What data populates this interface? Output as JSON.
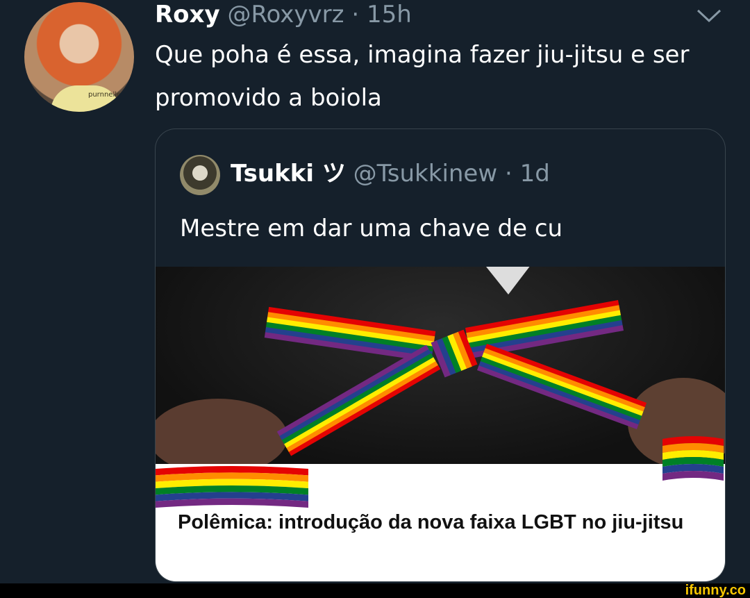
{
  "tweet": {
    "name": "Roxy",
    "handle": "@Roxyvrz",
    "separator": "·",
    "time": "15h",
    "text": "Que poha é essa, imagina fazer jiu-jitsu e ser promovido a boiola",
    "avatar_shirt_text": "purnnelle"
  },
  "quoted": {
    "name": "Tsukki ツ",
    "handle": "@Tsukkinew",
    "separator": "·",
    "time": "1d",
    "text": "Mestre em dar uma chave de cu",
    "caption": "Polêmica: introdução da nova faixa LGBT no jiu-jitsu"
  },
  "watermark": "ifunny.co",
  "colors": {
    "background": "#15202b",
    "muted": "#8899a6",
    "border": "#38444d",
    "rainbow": [
      "#e40303",
      "#ff8c00",
      "#ffed00",
      "#008026",
      "#24408e",
      "#732982"
    ]
  }
}
